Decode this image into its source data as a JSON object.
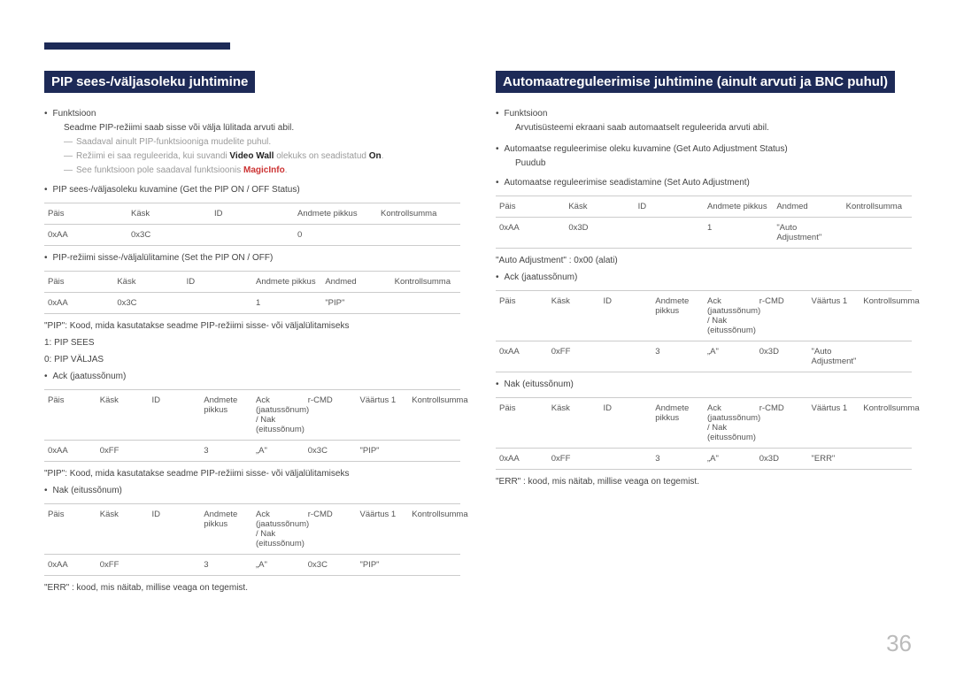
{
  "pageNumber": "36",
  "left": {
    "title": "PIP sees-/väljasoleku juhtimine",
    "function_label": "Funktsioon",
    "function_text": "Seadme PIP-režiimi saab sisse või välja lülitada arvuti abil.",
    "note1": "Saadaval ainult PIP-funktsiooniga mudelite puhul.",
    "note2_pre": "Režiimi ei saa reguleerida, kui suvandi ",
    "note2_bold1": "Video Wall",
    "note2_mid": " olekuks on seadistatud ",
    "note2_bold2": "On",
    "note2_post": ".",
    "note3_pre": "See funktsioon pole saadaval funktsioonis ",
    "note3_red": "MagicInfo",
    "note3_post": ".",
    "bullet2": "PIP sees-/väljasoleku kuvamine (Get the PIP ON / OFF Status)",
    "t1": {
      "h": [
        "Päis",
        "Käsk",
        "ID",
        "Andmete pikkus",
        "Kontrollsumma"
      ],
      "r": [
        "0xAA",
        "0x3C",
        "",
        "0",
        ""
      ]
    },
    "bullet3": "PIP-režiimi sisse-/väljalülitamine (Set the PIP ON / OFF)",
    "t2": {
      "h": [
        "Päis",
        "Käsk",
        "ID",
        "Andmete pikkus",
        "Andmed",
        "Kontrollsumma"
      ],
      "r": [
        "0xAA",
        "0x3C",
        "",
        "1",
        "\"PIP\"",
        ""
      ]
    },
    "kv1": "\"PIP\": Kood, mida kasutatakse seadme PIP-režiimi sisse- või väljalülitamiseks",
    "kv2": "1: PIP SEES",
    "kv3": "0: PIP VÄLJAS",
    "bullet4": "Ack (jaatussõnum)",
    "t3": {
      "h": [
        "Päis",
        "Käsk",
        "ID",
        "Andmete pikkus",
        "Ack (jaatussõnum) / Nak (eitussõnum)",
        "r-CMD",
        "Väärtus 1",
        "Kontrollsumma"
      ],
      "r": [
        "0xAA",
        "0xFF",
        "",
        "3",
        "„A\"",
        "0x3C",
        "\"PIP\"",
        ""
      ]
    },
    "kv4": "\"PIP\": Kood, mida kasutatakse seadme PIP-režiimi sisse- või väljalülitamiseks",
    "bullet5": "Nak (eitussõnum)",
    "t4": {
      "h": [
        "Päis",
        "Käsk",
        "ID",
        "Andmete pikkus",
        "Ack (jaatussõnum) / Nak (eitussõnum)",
        "r-CMD",
        "Väärtus 1",
        "Kontrollsumma"
      ],
      "r": [
        "0xAA",
        "0xFF",
        "",
        "3",
        "„A\"",
        "0x3C",
        "\"PIP\"",
        ""
      ]
    },
    "err_note": "\"ERR\" : kood, mis näitab, millise veaga on tegemist."
  },
  "right": {
    "title": "Automaatreguleerimise juhtimine (ainult arvuti ja BNC puhul)",
    "function_label": "Funktsioon",
    "function_text": "Arvutisüsteemi ekraani saab automaatselt reguleerida arvuti abil.",
    "bullet2a": "Automaatse reguleerimise oleku kuvamine (Get Auto Adjustment Status)",
    "bullet2b": "Puudub",
    "bullet3": "Automaatse reguleerimise seadistamine (Set Auto Adjustment)",
    "t1": {
      "h": [
        "Päis",
        "Käsk",
        "ID",
        "Andmete pikkus",
        "Andmed",
        "Kontrollsumma"
      ],
      "r": [
        "0xAA",
        "0x3D",
        "",
        "1",
        "\"Auto Adjustment\"",
        ""
      ]
    },
    "kv1": "\"Auto Adjustment\" : 0x00 (alati)",
    "bullet4": "Ack (jaatussõnum)",
    "t2": {
      "h": [
        "Päis",
        "Käsk",
        "ID",
        "Andmete pikkus",
        "Ack (jaatussõnum) / Nak (eitussõnum)",
        "r-CMD",
        "Väärtus 1",
        "Kontrollsumma"
      ],
      "r": [
        "0xAA",
        "0xFF",
        "",
        "3",
        "„A\"",
        "0x3D",
        "\"Auto Adjustment\"",
        ""
      ]
    },
    "bullet5": "Nak (eitussõnum)",
    "t3": {
      "h": [
        "Päis",
        "Käsk",
        "ID",
        "Andmete pikkus",
        "Ack (jaatussõnum) / Nak (eitussõnum)",
        "r-CMD",
        "Väärtus 1",
        "Kontrollsumma"
      ],
      "r": [
        "0xAA",
        "0xFF",
        "",
        "3",
        "„A\"",
        "0x3D",
        "\"ERR\"",
        ""
      ]
    },
    "err_note": "\"ERR\" : kood, mis näitab, millise veaga on tegemist."
  }
}
